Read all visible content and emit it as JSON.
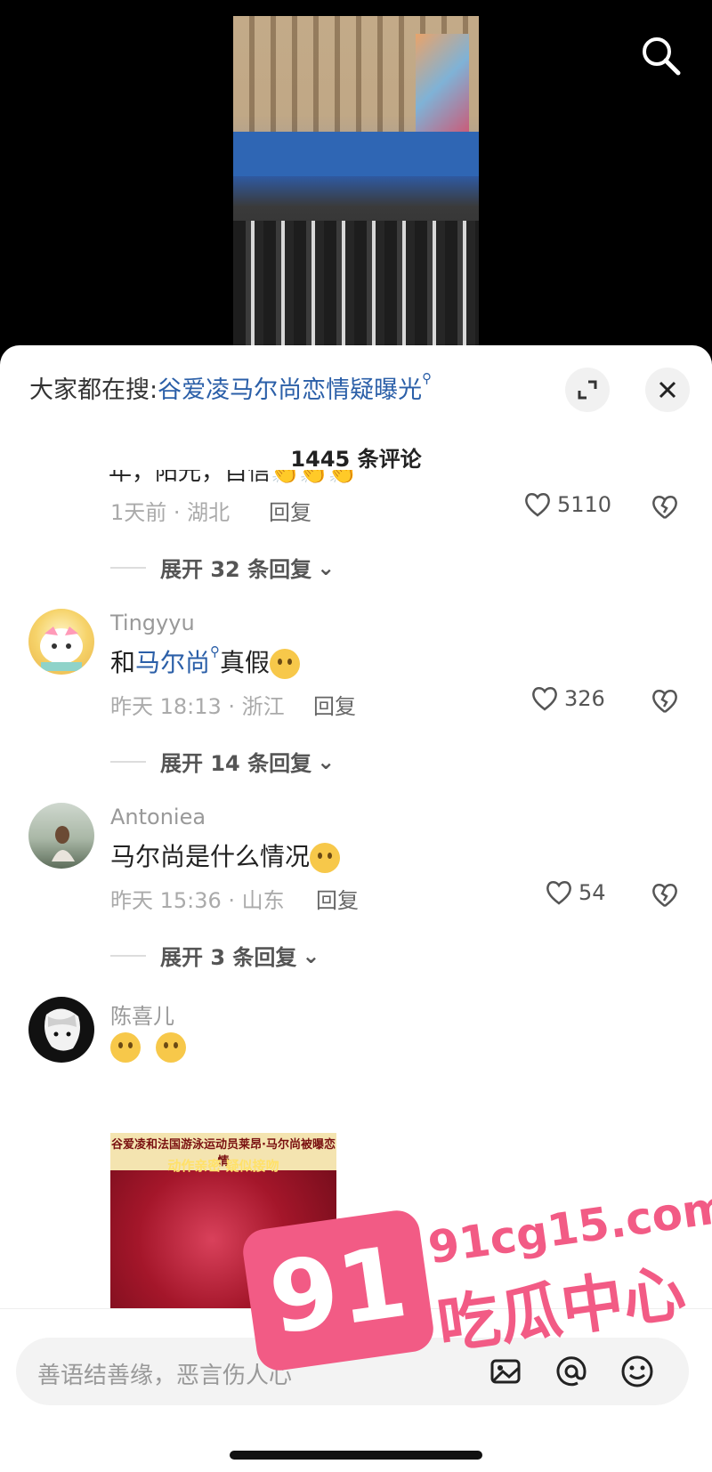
{
  "hot_search": {
    "prefix": "大家都在搜:",
    "keyword": "谷爱凌马尔尚恋情疑曝光",
    "mag": "⚲"
  },
  "comment_count": "1445 条评论",
  "cut_comment": {
    "text": "年，阳光，自信👏👏👏",
    "time_loc": "1天前 · 湖北",
    "reply": "回复",
    "likes": "5110",
    "expand": "展开 32 条回复"
  },
  "comments": [
    {
      "username": "Tingyyu",
      "text_before": "和",
      "link": "马尔尚",
      "text_after": "真假",
      "time_loc": "昨天 18:13 · 浙江",
      "reply": "回复",
      "likes": "326",
      "expand": "展开 14 条回复"
    },
    {
      "username": "Antoniea",
      "text": "马尔尚是什么情况",
      "time_loc": "昨天 15:36 · 山东",
      "reply": "回复",
      "likes": "54",
      "expand": "展开 3 条回复"
    },
    {
      "username": "陈喜儿",
      "image_caption": "谷爱凌和法国游泳运动员莱昂·马尔尚被曝恋情",
      "image_caption2": "动作亲密 疑似接吻"
    }
  ],
  "input": {
    "placeholder": "善语结善缘，恶言伤人心"
  },
  "watermark": {
    "number": "91",
    "url": "91cg15.com",
    "name": "吃瓜中心"
  },
  "colors": {
    "link": "#2b5fa8",
    "watermark": "#f25b85"
  }
}
